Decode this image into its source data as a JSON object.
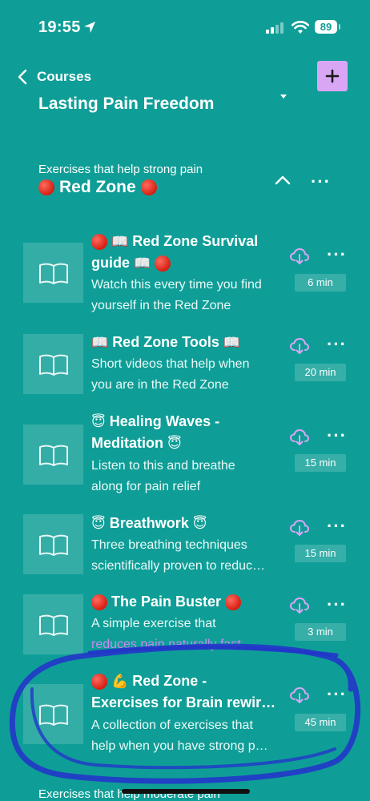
{
  "status": {
    "time": "19:55",
    "battery": "89"
  },
  "header": {
    "back_label": "Courses",
    "course_title": "Lasting Pain Freedom",
    "add_label": "+"
  },
  "section": {
    "subtitle": "Exercises that help strong pain",
    "title": "Red Zone",
    "more": "···"
  },
  "items": [
    {
      "title_line1": "Red Zone Survival",
      "title_line2": "guide",
      "desc_line1": "Watch this every time you find",
      "desc_line2": "yourself in the Red Zone",
      "duration": "6 min",
      "more": "···"
    },
    {
      "title_line1": "Red Zone Tools",
      "desc_line1": "Short videos that help when",
      "desc_line2": "you are in the Red Zone",
      "duration": "20 min",
      "more": "···"
    },
    {
      "title_line1": "Healing Waves -",
      "title_line2": "Meditation",
      "desc_line1": "Listen to this and breathe",
      "desc_line2": "along for pain relief",
      "duration": "15 min",
      "more": "···"
    },
    {
      "title_line1": "Breathwork",
      "desc_line1": "Three breathing techniques",
      "desc_line2": "scientifically proven to reduc…",
      "duration": "15 min",
      "more": "···"
    },
    {
      "title_line1": "The Pain Buster",
      "desc_line1": "A simple exercise that",
      "desc_line2": "reduces pain naturally fast",
      "duration": "3 min",
      "more": "···"
    },
    {
      "title_line1": "Red Zone -",
      "title_line2": "Exercises for Brain rewir…",
      "desc_line1": "A collection of exercises that",
      "desc_line2": "help when you have strong p…",
      "duration": "45 min",
      "more": "···"
    }
  ],
  "next_section_subtitle": "Exercises that help moderate pain",
  "colors": {
    "background": "#0f9e97",
    "accent": "#d9a6f5",
    "highlight": "#c58bf5",
    "annotation": "#2236c9"
  }
}
